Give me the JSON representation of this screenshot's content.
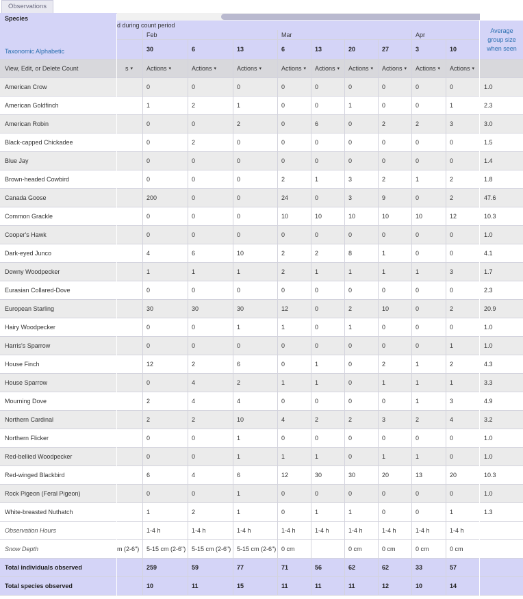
{
  "tab": {
    "label": "Observations"
  },
  "header": {
    "species": "Species",
    "sort_link": "Taxonomic Alphabetic",
    "period_fragment": "d during count period",
    "months": [
      "Feb",
      "Mar",
      "Apr"
    ],
    "view_edit": "View, Edit, or Delete Count",
    "average_label": "Average group size when seen",
    "actions_label": "Actions",
    "partial_actions": "s"
  },
  "days": [
    "30",
    "6",
    "13",
    "6",
    "13",
    "20",
    "27",
    "3",
    "10"
  ],
  "species": [
    {
      "name": "American Crow",
      "counts": [
        "0",
        "0",
        "0",
        "0",
        "0",
        "0",
        "0",
        "0",
        "0"
      ],
      "avg": "1.0"
    },
    {
      "name": "American Goldfinch",
      "counts": [
        "1",
        "2",
        "1",
        "0",
        "0",
        "1",
        "0",
        "0",
        "1"
      ],
      "avg": "2.3"
    },
    {
      "name": "American Robin",
      "counts": [
        "0",
        "0",
        "2",
        "0",
        "6",
        "0",
        "2",
        "2",
        "3"
      ],
      "avg": "3.0"
    },
    {
      "name": "Black-capped Chickadee",
      "counts": [
        "0",
        "2",
        "0",
        "0",
        "0",
        "0",
        "0",
        "0",
        "0"
      ],
      "avg": "1.5"
    },
    {
      "name": "Blue Jay",
      "counts": [
        "0",
        "0",
        "0",
        "0",
        "0",
        "0",
        "0",
        "0",
        "0"
      ],
      "avg": "1.4"
    },
    {
      "name": "Brown-headed Cowbird",
      "counts": [
        "0",
        "0",
        "0",
        "2",
        "1",
        "3",
        "2",
        "1",
        "2"
      ],
      "avg": "1.8"
    },
    {
      "name": "Canada Goose",
      "counts": [
        "200",
        "0",
        "0",
        "24",
        "0",
        "3",
        "9",
        "0",
        "2"
      ],
      "avg": "47.6"
    },
    {
      "name": "Common Grackle",
      "counts": [
        "0",
        "0",
        "0",
        "10",
        "10",
        "10",
        "10",
        "10",
        "12"
      ],
      "avg": "10.3"
    },
    {
      "name": "Cooper's Hawk",
      "counts": [
        "0",
        "0",
        "0",
        "0",
        "0",
        "0",
        "0",
        "0",
        "0"
      ],
      "avg": "1.0"
    },
    {
      "name": "Dark-eyed Junco",
      "counts": [
        "4",
        "6",
        "10",
        "2",
        "2",
        "8",
        "1",
        "0",
        "0"
      ],
      "avg": "4.1"
    },
    {
      "name": "Downy Woodpecker",
      "counts": [
        "1",
        "1",
        "1",
        "2",
        "1",
        "1",
        "1",
        "1",
        "3"
      ],
      "avg": "1.7"
    },
    {
      "name": "Eurasian Collared-Dove",
      "counts": [
        "0",
        "0",
        "0",
        "0",
        "0",
        "0",
        "0",
        "0",
        "0"
      ],
      "avg": "2.3"
    },
    {
      "name": "European Starling",
      "counts": [
        "30",
        "30",
        "30",
        "12",
        "0",
        "2",
        "10",
        "0",
        "2"
      ],
      "avg": "20.9"
    },
    {
      "name": "Hairy Woodpecker",
      "counts": [
        "0",
        "0",
        "1",
        "1",
        "0",
        "1",
        "0",
        "0",
        "0"
      ],
      "avg": "1.0"
    },
    {
      "name": "Harris's Sparrow",
      "counts": [
        "0",
        "0",
        "0",
        "0",
        "0",
        "0",
        "0",
        "0",
        "1"
      ],
      "avg": "1.0"
    },
    {
      "name": "House Finch",
      "counts": [
        "12",
        "2",
        "6",
        "0",
        "1",
        "0",
        "2",
        "1",
        "2"
      ],
      "avg": "4.3"
    },
    {
      "name": "House Sparrow",
      "counts": [
        "0",
        "4",
        "2",
        "1",
        "1",
        "0",
        "1",
        "1",
        "1"
      ],
      "avg": "3.3"
    },
    {
      "name": "Mourning Dove",
      "counts": [
        "2",
        "4",
        "4",
        "0",
        "0",
        "0",
        "0",
        "1",
        "3"
      ],
      "avg": "4.9"
    },
    {
      "name": "Northern Cardinal",
      "counts": [
        "2",
        "2",
        "10",
        "4",
        "2",
        "2",
        "3",
        "2",
        "4"
      ],
      "avg": "3.2"
    },
    {
      "name": "Northern Flicker",
      "counts": [
        "0",
        "0",
        "1",
        "0",
        "0",
        "0",
        "0",
        "0",
        "0"
      ],
      "avg": "1.0"
    },
    {
      "name": "Red-bellied Woodpecker",
      "counts": [
        "0",
        "0",
        "1",
        "1",
        "1",
        "0",
        "1",
        "1",
        "0"
      ],
      "avg": "1.0"
    },
    {
      "name": "Red-winged Blackbird",
      "counts": [
        "6",
        "4",
        "6",
        "12",
        "30",
        "30",
        "20",
        "13",
        "20"
      ],
      "avg": "10.3"
    },
    {
      "name": "Rock Pigeon (Feral Pigeon)",
      "counts": [
        "0",
        "0",
        "1",
        "0",
        "0",
        "0",
        "0",
        "0",
        "0"
      ],
      "avg": "1.0"
    },
    {
      "name": "White-breasted Nuthatch",
      "counts": [
        "1",
        "2",
        "1",
        "0",
        "1",
        "1",
        "0",
        "0",
        "1"
      ],
      "avg": "1.3"
    }
  ],
  "observation_hours": {
    "label": "Observation Hours",
    "values": [
      "1-4 h",
      "1-4 h",
      "1-4 h",
      "1-4 h",
      "1-4 h",
      "1-4 h",
      "1-4 h",
      "1-4 h",
      "1-4 h"
    ]
  },
  "snow_depth": {
    "label": "Snow Depth",
    "partial": "m (2-6\")",
    "values": [
      "5-15 cm (2-6\")",
      "5-15 cm (2-6\")",
      "5-15 cm (2-6\")",
      "0 cm",
      "",
      "0 cm",
      "0 cm",
      "0 cm",
      "0 cm"
    ]
  },
  "totals": {
    "individuals": {
      "label": "Total individuals observed",
      "values": [
        "259",
        "59",
        "77",
        "71",
        "56",
        "62",
        "62",
        "33",
        "57"
      ]
    },
    "species": {
      "label": "Total species observed",
      "values": [
        "10",
        "11",
        "15",
        "11",
        "11",
        "11",
        "12",
        "10",
        "14"
      ]
    }
  }
}
